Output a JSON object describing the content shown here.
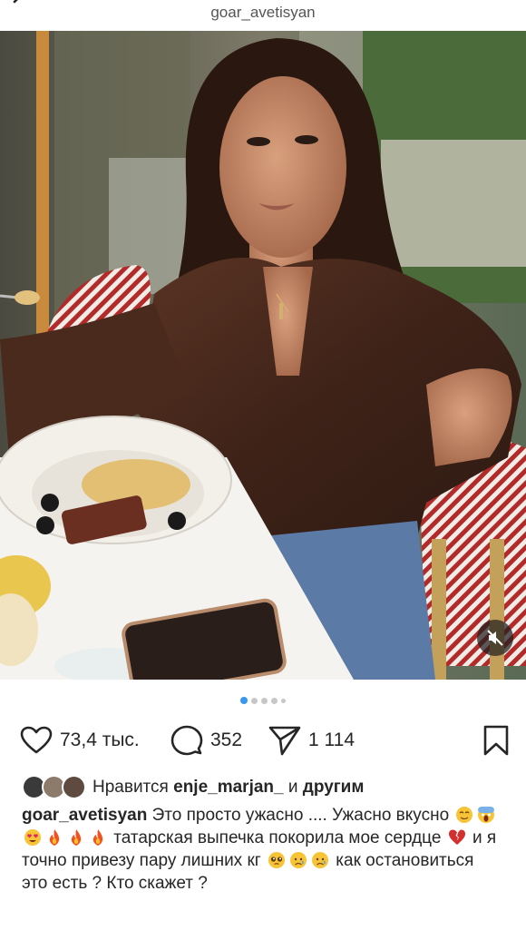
{
  "header": {
    "username": "goar_avetisyan"
  },
  "carousel": {
    "total": 5,
    "active_index": 0
  },
  "actions": {
    "likes_count": "73,4 тыс.",
    "comments_count": "352",
    "shares_count": "1 114"
  },
  "liked_by": {
    "prefix": "Нравится",
    "user": "enje_marjan_",
    "connector": "и",
    "others": "другим"
  },
  "caption": {
    "username": "goar_avetisyan",
    "part1": "Это просто ужасно .... Ужасно вкусно",
    "part2": "татарская  выпечка покорила мое сердце",
    "part3": "и я точно привезу пару лишних кг",
    "part4": "как остановиться это есть ? Кто скажет ?"
  },
  "icons": {
    "back": "back-arrow-icon",
    "like": "heart-icon",
    "comment": "comment-bubble-icon",
    "share": "paper-plane-icon",
    "save": "bookmark-icon",
    "mute": "speaker-muted-icon"
  }
}
